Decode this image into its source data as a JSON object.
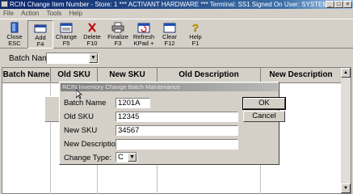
{
  "window": {
    "title": "RCIN Change Item Number - Store: 1   *** ACTIVANT HARDWARE ***   Terminal: SS1   Signed On User: SYSTEM"
  },
  "menu": [
    "File",
    "Action",
    "Tools",
    "Help"
  ],
  "toolbar": [
    {
      "label": "Close",
      "key": "ESC",
      "icon": "close-door-icon"
    },
    {
      "label": "Add",
      "key": "F4",
      "icon": "add-icon"
    },
    {
      "label": "Change",
      "key": "F5",
      "icon": "change-icon"
    },
    {
      "label": "Delete",
      "key": "F10",
      "icon": "delete-x-icon"
    },
    {
      "label": "Finalize",
      "key": "F3",
      "icon": "finalize-printer-icon"
    },
    {
      "label": "Refresh",
      "key": "KPad +",
      "icon": "refresh-icon"
    },
    {
      "label": "Clear",
      "key": "F12",
      "icon": "clear-icon"
    },
    {
      "label": "Help",
      "key": "F1",
      "icon": "help-question-icon"
    }
  ],
  "batch": {
    "label": "Batch Name",
    "value": ""
  },
  "grid": {
    "columns": [
      "Batch Name",
      "Old SKU",
      "New SKU",
      "Old Description",
      "New Description"
    ]
  },
  "dialog": {
    "title": "RCIN Inventory Change Batch Maintenance",
    "batch_name_label": "Batch Name",
    "batch_name_value": "1201A",
    "old_sku_label": "Old SKU",
    "old_sku_value": "12345",
    "new_sku_label": "New SKU",
    "new_sku_value": "34567",
    "new_desc_label": "New Description",
    "new_desc_value": "",
    "change_type_label": "Change Type:",
    "change_type_value": "C",
    "ok_label": "OK",
    "cancel_label": "Cancel"
  },
  "colors": {
    "title_active": "#0a246a",
    "title_inactive": "#808080",
    "face": "#d4d0c8"
  }
}
